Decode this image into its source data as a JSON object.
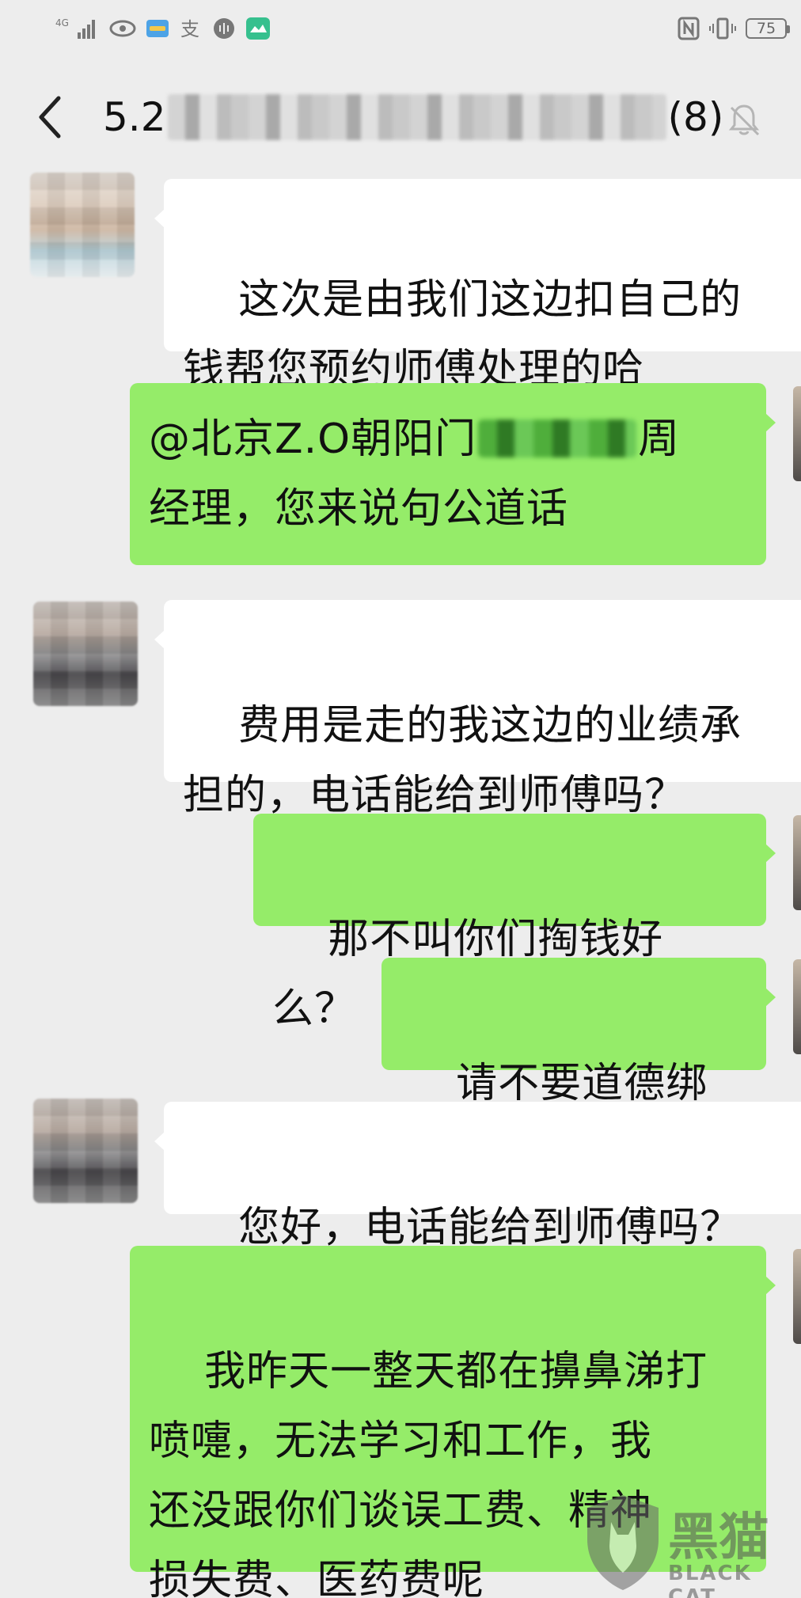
{
  "status_bar": {
    "network": "4G",
    "battery": "75",
    "icons": [
      "signal-icon",
      "eye-icon",
      "wallet-icon",
      "alipay-icon",
      "audio-icon",
      "app-icon",
      "nfc-icon",
      "vibrate-icon",
      "battery-icon"
    ]
  },
  "header": {
    "title_prefix": "5.2",
    "title_suffix": "(8)",
    "back_icon": "back-arrow-icon",
    "mute_icon": "bell-muted-icon"
  },
  "messages": [
    {
      "side": "left",
      "text": "这次是由我们这边扣自己的\n钱帮您预约师傅处理的哈"
    },
    {
      "side": "right",
      "text_a": "@北京Z.O朝阳门",
      "text_b": "周\n经理，您来说句公道话"
    },
    {
      "side": "left",
      "text": "费用是走的我这边的业绩承\n担的，电话能给到师傅吗？"
    },
    {
      "side": "right",
      "text": "那不叫你们掏钱好么？"
    },
    {
      "side": "right",
      "text": "请不要道德绑架"
    },
    {
      "side": "left",
      "text": "您好，电话能给到师傅吗？"
    },
    {
      "side": "right",
      "text": "我昨天一整天都在擤鼻涕打\n喷嚏，无法学习和工作，我\n还没跟你们谈误工费、精神\n损失费、医药费呢"
    }
  ],
  "watermark": {
    "logo": "black-cat-logo",
    "text": "黑猫",
    "sub": "BLACK CAT"
  },
  "colors": {
    "background": "#ededed",
    "bubble_left": "#ffffff",
    "bubble_right": "#95ec69"
  }
}
